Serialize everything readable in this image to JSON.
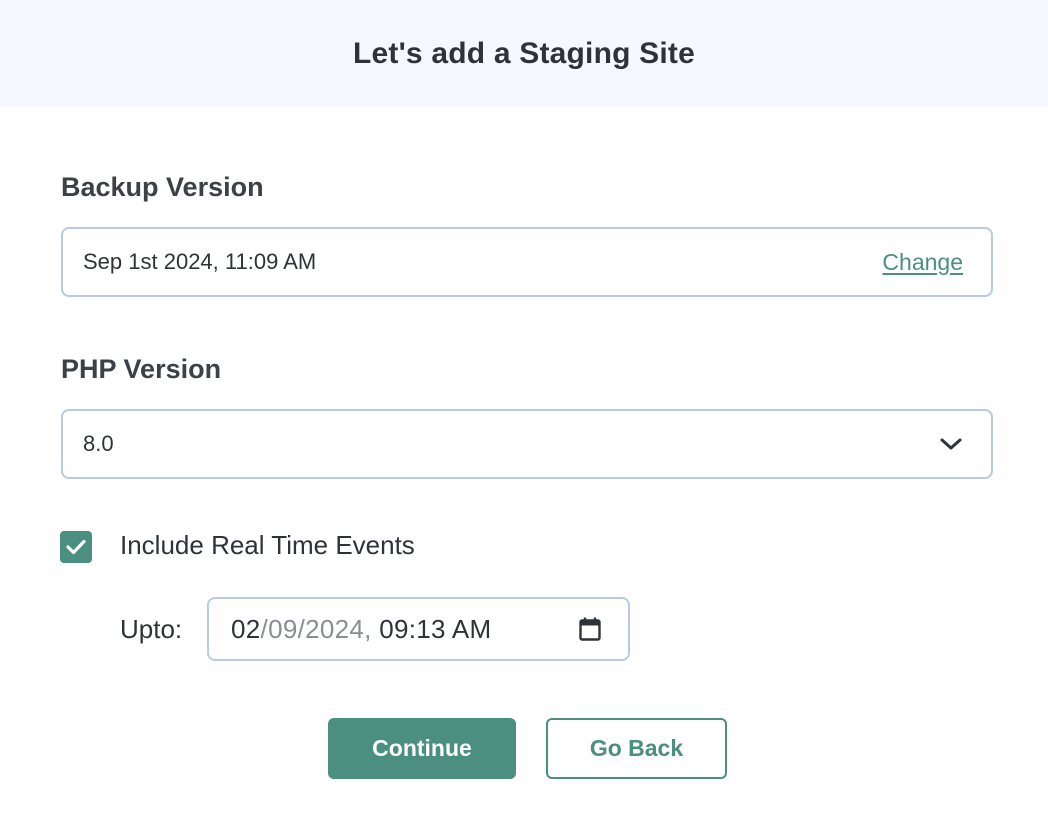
{
  "header": {
    "title": "Let's add a Staging Site"
  },
  "backup": {
    "label": "Backup Version",
    "value": "Sep 1st 2024, 11:09 AM",
    "change_label": "Change"
  },
  "php": {
    "label": "PHP Version",
    "selected": "8.0",
    "icon": "chevron-down-icon"
  },
  "realtime": {
    "checked": true,
    "label": "Include Real Time Events",
    "upto_label": "Upto:",
    "date_day": "02",
    "date_sep1": "/",
    "date_month": "09",
    "date_sep2": "/",
    "date_year": "2024",
    "date_comma": ",",
    "time": "09:13",
    "ampm": "AM",
    "icon": "calendar-icon"
  },
  "actions": {
    "continue_label": "Continue",
    "back_label": "Go Back"
  },
  "colors": {
    "accent": "#4a8f80",
    "header_bg": "#f5f9fd",
    "field_border": "#b7cbe6"
  }
}
